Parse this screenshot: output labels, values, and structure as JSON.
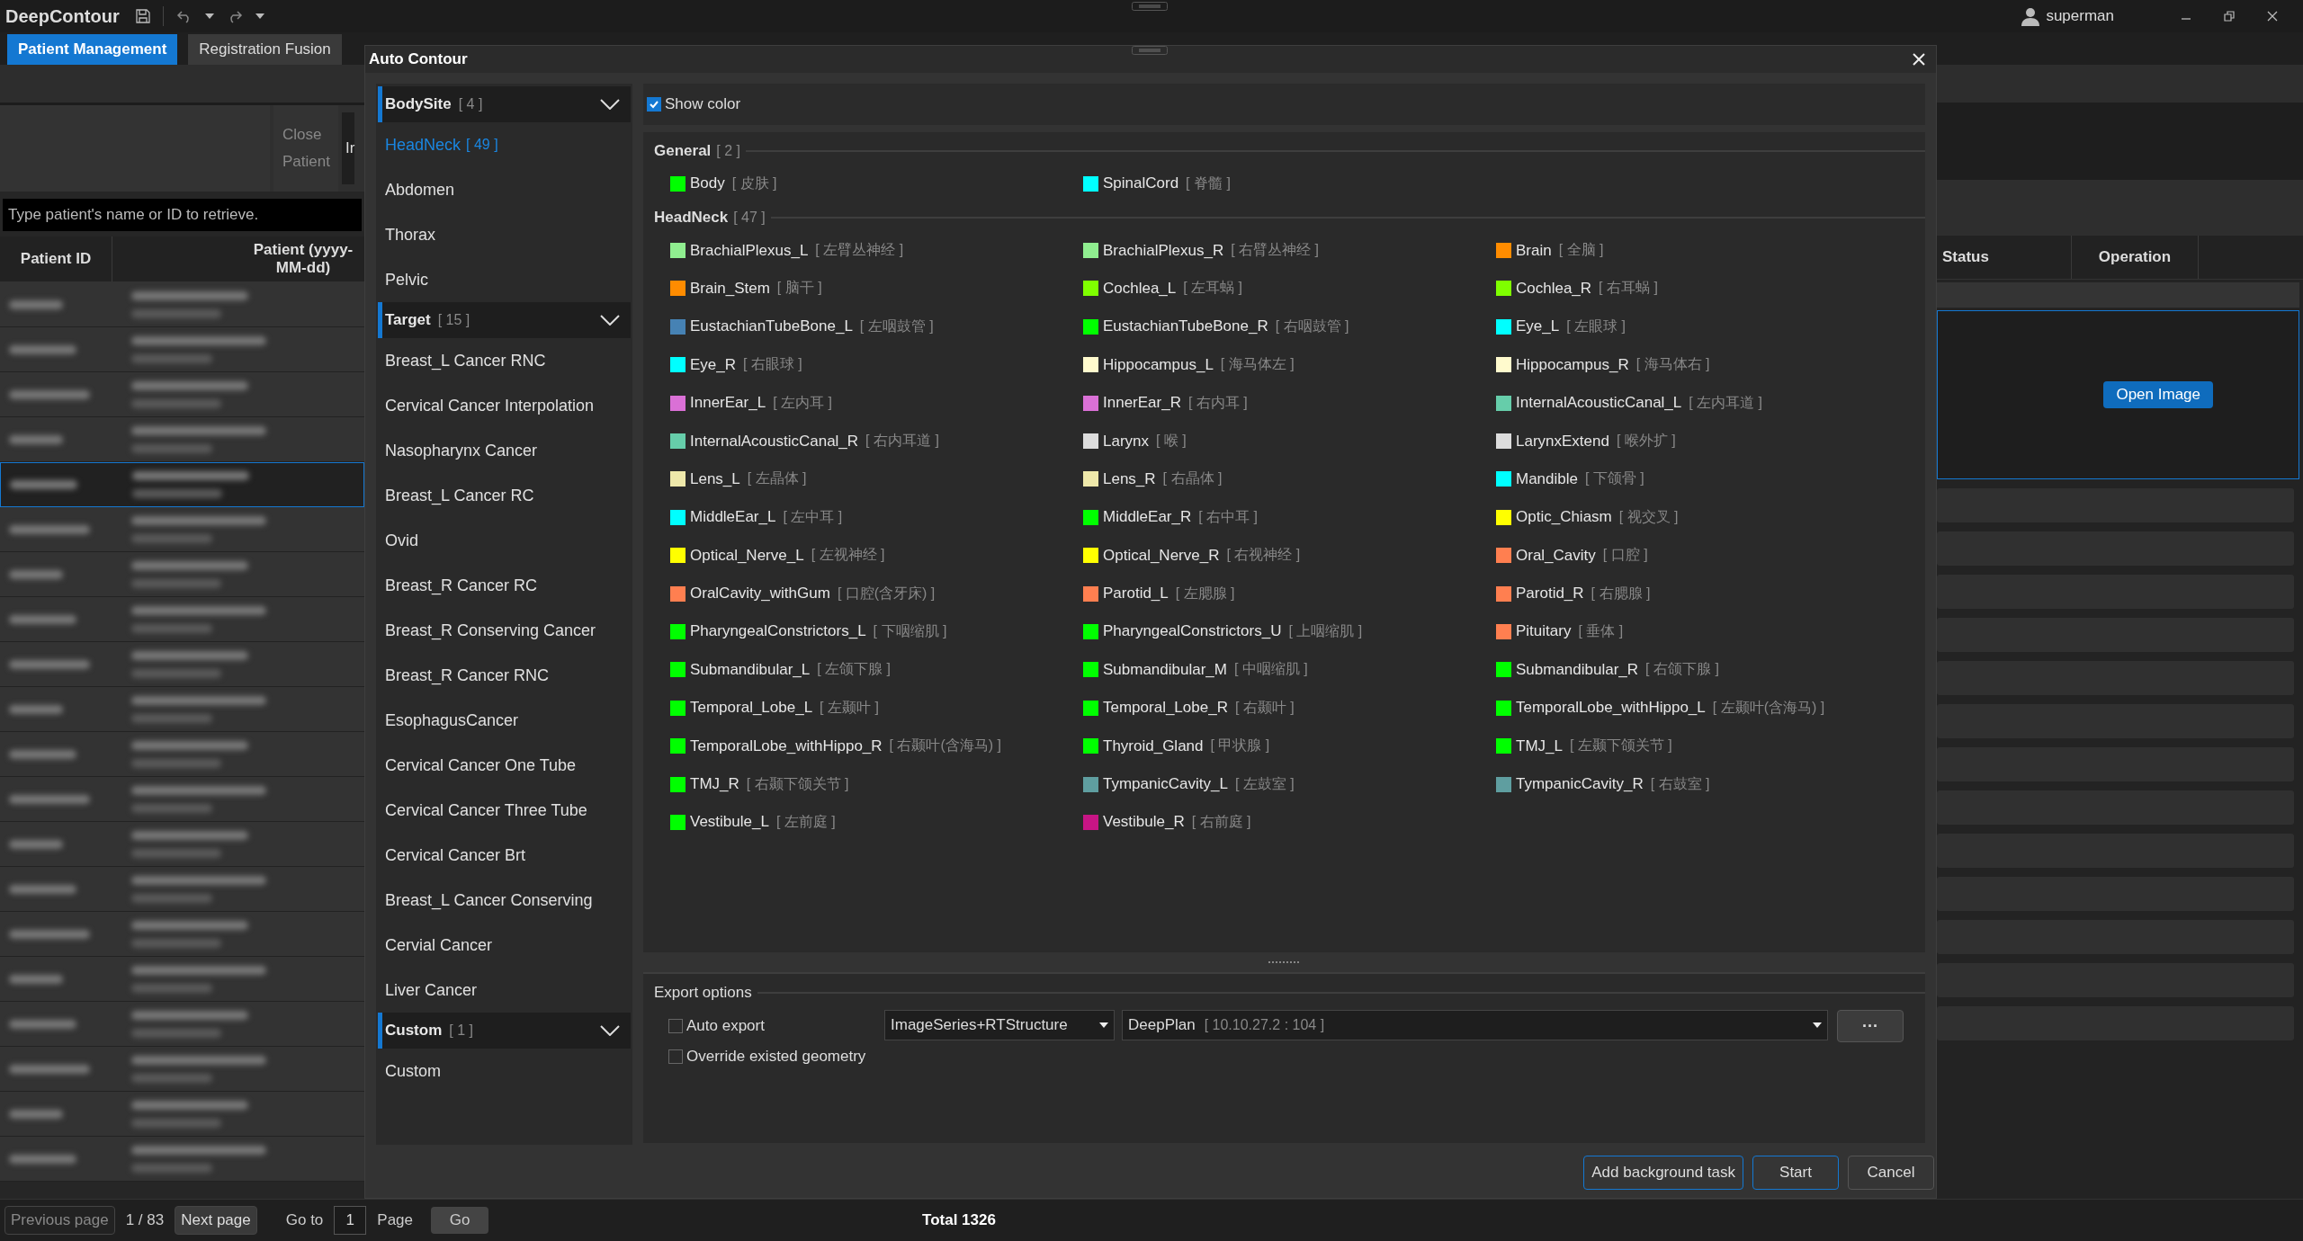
{
  "app": {
    "title": "DeepContour",
    "user": "superman"
  },
  "tabs": [
    {
      "label": "Patient Management",
      "selected": true
    },
    {
      "label": "Registration Fusion",
      "selected": false
    }
  ],
  "patient_panel": {
    "close_button": "Close Patient",
    "cut_label": "Ir",
    "search": {
      "placeholder": "Type patient's name or ID to retrieve."
    },
    "columns": [
      "Patient ID",
      "Patient (yyyy-MM-dd)"
    ],
    "rows": [
      {
        "selected": false
      },
      {
        "selected": false
      },
      {
        "selected": false
      },
      {
        "selected": false
      },
      {
        "selected": true
      },
      {
        "selected": false
      },
      {
        "selected": false
      },
      {
        "selected": false
      },
      {
        "selected": false
      },
      {
        "selected": false
      },
      {
        "selected": false
      },
      {
        "selected": false
      },
      {
        "selected": false
      },
      {
        "selected": false
      },
      {
        "selected": false
      },
      {
        "selected": false
      },
      {
        "selected": false
      },
      {
        "selected": false
      },
      {
        "selected": false
      },
      {
        "selected": false
      }
    ]
  },
  "pagination": {
    "previous": {
      "label": "Previous page",
      "disabled": true
    },
    "page_info": "1 / 83",
    "next": {
      "label": "Next page",
      "disabled": false
    },
    "goto_label": "Go to",
    "page_value": "1",
    "page_label": "Page",
    "go_button": "Go",
    "total": "Total 1326"
  },
  "task_table": {
    "columns": [
      "Status",
      "Operation"
    ],
    "open_button": "Open Image"
  },
  "dialog": {
    "title": "Auto Contour",
    "sections": [
      {
        "name": "BodySite",
        "count": "[ 4 ]",
        "expanded": true,
        "items": [
          {
            "label": "HeadNeck",
            "count": "[ 49 ]",
            "selected": true
          },
          {
            "label": "Abdomen",
            "selected": false
          },
          {
            "label": "Thorax",
            "selected": false
          },
          {
            "label": "Pelvic",
            "selected": false
          }
        ]
      },
      {
        "name": "Target",
        "count": "[ 15 ]",
        "expanded": true,
        "items": [
          {
            "label": "Breast_L Cancer RNC",
            "selected": false
          },
          {
            "label": "Cervical Cancer Interpolation",
            "selected": false
          },
          {
            "label": "Nasopharynx Cancer",
            "selected": false
          },
          {
            "label": "Breast_L Cancer RC",
            "selected": false
          },
          {
            "label": "Ovid",
            "selected": false
          },
          {
            "label": "Breast_R Cancer RC",
            "selected": false
          },
          {
            "label": "Breast_R Conserving Cancer",
            "selected": false
          },
          {
            "label": "Breast_R Cancer RNC",
            "selected": false
          },
          {
            "label": "EsophagusCancer",
            "selected": false
          },
          {
            "label": "Cervical Cancer One Tube",
            "selected": false
          },
          {
            "label": "Cervical Cancer Three Tube",
            "selected": false
          },
          {
            "label": "Cervical Cancer Brt",
            "selected": false
          },
          {
            "label": "Breast_L Cancer Conserving",
            "selected": false
          },
          {
            "label": "Cervial Cancer",
            "selected": false
          },
          {
            "label": "Liver Cancer",
            "selected": false
          }
        ]
      },
      {
        "name": "Custom",
        "count": "[ 1 ]",
        "expanded": true,
        "items": [
          {
            "label": "Custom",
            "selected": false
          }
        ]
      }
    ],
    "show_color": {
      "label": "Show color",
      "checked": true
    },
    "groups": [
      {
        "name": "General",
        "count": "[ 2 ]",
        "organs": [
          {
            "name": "Body",
            "alias": "[ 皮肤 ]",
            "color": "#00ff00"
          },
          {
            "name": "SpinalCord",
            "alias": "[ 脊髓 ]",
            "color": "#00ffff"
          }
        ]
      },
      {
        "name": "HeadNeck",
        "count": "[ 47 ]",
        "organs": [
          {
            "name": "BrachialPlexus_L",
            "alias": "[ 左臂丛神经 ]",
            "color": "#90ee90"
          },
          {
            "name": "BrachialPlexus_R",
            "alias": "[ 右臂丛神经 ]",
            "color": "#90ee90"
          },
          {
            "name": "Brain",
            "alias": "[ 全脑 ]",
            "color": "#ff8c00"
          },
          {
            "name": "Brain_Stem",
            "alias": "[ 脑干 ]",
            "color": "#ff8c00"
          },
          {
            "name": "Cochlea_L",
            "alias": "[ 左耳蜗 ]",
            "color": "#7fff00"
          },
          {
            "name": "Cochlea_R",
            "alias": "[ 右耳蜗 ]",
            "color": "#7fff00"
          },
          {
            "name": "EustachianTubeBone_L",
            "alias": "[ 左咽鼓管 ]",
            "color": "#4682b4"
          },
          {
            "name": "EustachianTubeBone_R",
            "alias": "[ 右咽鼓管 ]",
            "color": "#00ff00"
          },
          {
            "name": "Eye_L",
            "alias": "[ 左眼球 ]",
            "color": "#00ffff"
          },
          {
            "name": "Eye_R",
            "alias": "[ 右眼球 ]",
            "color": "#00ffff"
          },
          {
            "name": "Hippocampus_L",
            "alias": "[ 海马体左 ]",
            "color": "#fffacd"
          },
          {
            "name": "Hippocampus_R",
            "alias": "[ 海马体右 ]",
            "color": "#fffacd"
          },
          {
            "name": "InnerEar_L",
            "alias": "[ 左内耳 ]",
            "color": "#da70d6"
          },
          {
            "name": "InnerEar_R",
            "alias": "[ 右内耳 ]",
            "color": "#da70d6"
          },
          {
            "name": "InternalAcousticCanal_L",
            "alias": "[ 左内耳道 ]",
            "color": "#66cdaa"
          },
          {
            "name": "InternalAcousticCanal_R",
            "alias": "[ 右内耳道 ]",
            "color": "#66cdaa"
          },
          {
            "name": "Larynx",
            "alias": "[ 喉 ]",
            "color": "#dcdcdc"
          },
          {
            "name": "LarynxExtend",
            "alias": "[ 喉外扩 ]",
            "color": "#dcdcdc"
          },
          {
            "name": "Lens_L",
            "alias": "[ 左晶体 ]",
            "color": "#eee8aa"
          },
          {
            "name": "Lens_R",
            "alias": "[ 右晶体 ]",
            "color": "#eee8aa"
          },
          {
            "name": "Mandible",
            "alias": "[ 下颌骨 ]",
            "color": "#00ffff"
          },
          {
            "name": "MiddleEar_L",
            "alias": "[ 左中耳 ]",
            "color": "#00ffff"
          },
          {
            "name": "MiddleEar_R",
            "alias": "[ 右中耳 ]",
            "color": "#00ff00"
          },
          {
            "name": "Optic_Chiasm",
            "alias": "[ 视交叉 ]",
            "color": "#ffff00"
          },
          {
            "name": "Optical_Nerve_L",
            "alias": "[ 左视神经 ]",
            "color": "#ffff00"
          },
          {
            "name": "Optical_Nerve_R",
            "alias": "[ 右视神经 ]",
            "color": "#ffff00"
          },
          {
            "name": "Oral_Cavity",
            "alias": "[ 口腔 ]",
            "color": "#ff7f50"
          },
          {
            "name": "OralCavity_withGum",
            "alias": "[ 口腔(含牙床) ]",
            "color": "#ff7f50"
          },
          {
            "name": "Parotid_L",
            "alias": "[ 左腮腺 ]",
            "color": "#ff7f50"
          },
          {
            "name": "Parotid_R",
            "alias": "[ 右腮腺 ]",
            "color": "#ff7f50"
          },
          {
            "name": "PharyngealConstrictors_L",
            "alias": "[ 下咽缩肌 ]",
            "color": "#00ff00"
          },
          {
            "name": "PharyngealConstrictors_U",
            "alias": "[ 上咽缩肌 ]",
            "color": "#00ff00"
          },
          {
            "name": "Pituitary",
            "alias": "[ 垂体 ]",
            "color": "#ff7f50"
          },
          {
            "name": "Submandibular_L",
            "alias": "[ 左颌下腺 ]",
            "color": "#00ff00"
          },
          {
            "name": "Submandibular_M",
            "alias": "[ 中咽缩肌 ]",
            "color": "#00ff00"
          },
          {
            "name": "Submandibular_R",
            "alias": "[ 右颌下腺 ]",
            "color": "#00ff00"
          },
          {
            "name": "Temporal_Lobe_L",
            "alias": "[ 左颞叶 ]",
            "color": "#00ff00"
          },
          {
            "name": "Temporal_Lobe_R",
            "alias": "[ 右颞叶 ]",
            "color": "#00ff00"
          },
          {
            "name": "TemporalLobe_withHippo_L",
            "alias": "[ 左颞叶(含海马) ]",
            "color": "#00ff00"
          },
          {
            "name": "TemporalLobe_withHippo_R",
            "alias": "[ 右颞叶(含海马) ]",
            "color": "#00ff00"
          },
          {
            "name": "Thyroid_Gland",
            "alias": "[ 甲状腺 ]",
            "color": "#00ff00"
          },
          {
            "name": "TMJ_L",
            "alias": "[ 左颞下颌关节 ]",
            "color": "#00ff00"
          },
          {
            "name": "TMJ_R",
            "alias": "[ 右颞下颌关节 ]",
            "color": "#00ff00"
          },
          {
            "name": "TympanicCavity_L",
            "alias": "[ 左鼓室 ]",
            "color": "#5f9ea0"
          },
          {
            "name": "TympanicCavity_R",
            "alias": "[ 右鼓室 ]",
            "color": "#5f9ea0"
          },
          {
            "name": "Vestibule_L",
            "alias": "[ 左前庭 ]",
            "color": "#00ff00"
          },
          {
            "name": "Vestibule_R",
            "alias": "[ 右前庭 ]",
            "color": "#c71585"
          }
        ]
      }
    ],
    "export": {
      "title": "Export options",
      "options": [
        {
          "label": "Auto export",
          "checked": false
        },
        {
          "label": "Override existed geometry",
          "checked": false
        }
      ],
      "format": "ImageSeries+RTStructure",
      "target": "DeepPlan",
      "target_address": "[ 10.10.27.2 : 104 ]",
      "more_button": "···"
    },
    "buttons": [
      {
        "label": "Add background task",
        "default": true
      },
      {
        "label": "Start",
        "default": true
      },
      {
        "label": "Cancel",
        "default": false
      }
    ]
  }
}
